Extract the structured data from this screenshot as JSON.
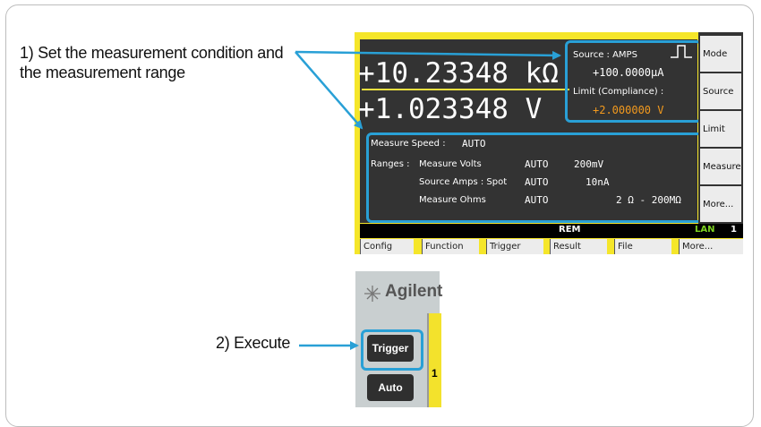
{
  "annotations": {
    "step1": "1) Set the measurement condition and the measurement range",
    "step2": "2) Execute"
  },
  "display": {
    "reading1": "+10.23348 kΩ",
    "reading2": "+1.023348  V",
    "source_label": "Source :  AMPS",
    "source_value": "+100.0000µA",
    "limit_label": "Limit (Compliance) :",
    "limit_value": "+2.000000  V",
    "speed_label": "Measure Speed :",
    "speed_value": "AUTO",
    "ranges_label": "Ranges :",
    "ranges": [
      {
        "name": "Measure Volts",
        "mode": "AUTO",
        "value": "200mV"
      },
      {
        "name": "Source Amps : Spot",
        "mode": "AUTO",
        "value": "10nA"
      },
      {
        "name": "Measure Ohms",
        "mode": "AUTO",
        "value": "2 Ω - 200MΩ"
      }
    ],
    "softkeys": [
      "Mode",
      "Source",
      "Limit",
      "Measure",
      "More..."
    ],
    "status_rem": "REM",
    "status_lan": "LAN",
    "status_num": "1",
    "function_keys": [
      "Config",
      "Function",
      "Trigger",
      "Result",
      "File",
      "More..."
    ]
  },
  "panel": {
    "brand": "Agilent",
    "trigger_button": "Trigger",
    "auto_button": "Auto",
    "channel": "1"
  },
  "colors": {
    "highlight": "#29a0d6",
    "screen_bezel": "#f5e62a",
    "limit_value": "#f39a1e"
  }
}
